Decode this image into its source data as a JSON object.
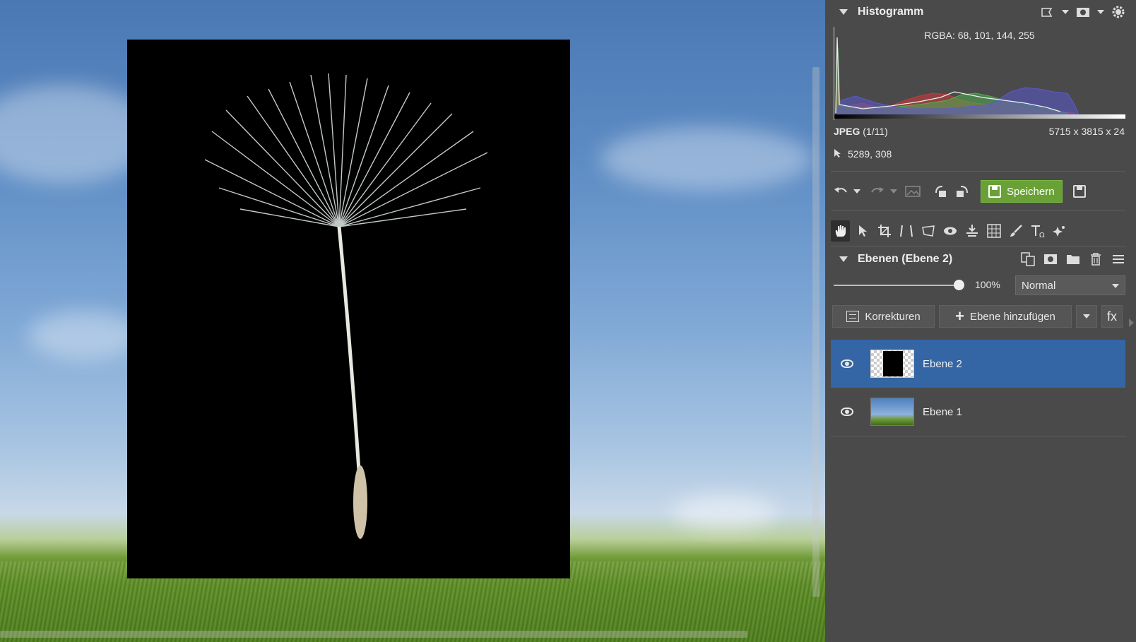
{
  "canvas": {
    "background_image": "sky-and-grass-photo",
    "foreground_image": "dandelion-seed-on-black"
  },
  "histogram": {
    "title": "Histogramm",
    "rgba_label": "RGBA:",
    "rgba_values": "68, 101, 144, 255",
    "series_colors": {
      "red": "#c43a3a",
      "green": "#4caf50",
      "blue": "#5a5ad0",
      "luminance": "#d8d8d8"
    }
  },
  "file_info": {
    "format": "JPEG",
    "index": "(1/11)",
    "dimensions": "5715 x 3815 x 24",
    "cursor_position": "5289, 308"
  },
  "actions": {
    "save_label": "Speichern"
  },
  "layers_panel": {
    "title": "Ebenen (Ebene 2)",
    "opacity": "100%",
    "opacity_fraction": 1.0,
    "blend_mode": "Normal",
    "corrections_label": "Korrekturen",
    "add_layer_label": "Ebene hinzufügen",
    "fx_label": "fx",
    "layers": [
      {
        "name": "Ebene 2",
        "visible": true,
        "selected": true
      },
      {
        "name": "Ebene 1",
        "visible": true,
        "selected": false
      }
    ]
  },
  "colors": {
    "save_button": "#6aa136",
    "selection": "#3465a4",
    "panel_bg": "#4a4a4a"
  }
}
